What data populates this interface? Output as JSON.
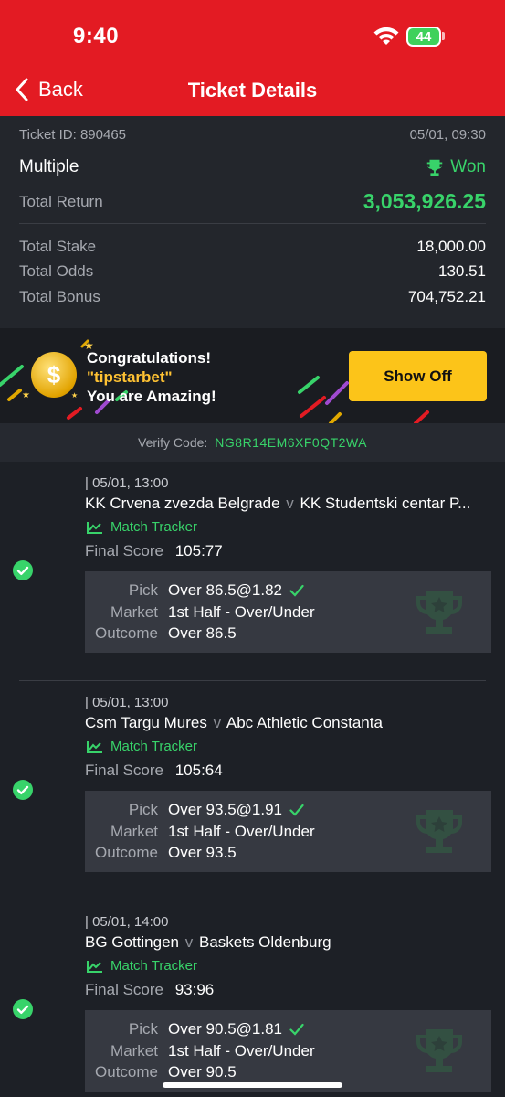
{
  "status": {
    "time": "9:40",
    "battery": "44"
  },
  "nav": {
    "back_label": "Back",
    "title": "Ticket Details"
  },
  "ticket": {
    "id_label": "Ticket ID: 890465",
    "datetime": "05/01, 09:30",
    "type": "Multiple",
    "status": "Won",
    "return_label": "Total Return",
    "return_value": "3,053,926.25",
    "stake_label": "Total Stake",
    "stake_value": "18,000.00",
    "odds_label": "Total Odds",
    "odds_value": "130.51",
    "bonus_label": "Total Bonus",
    "bonus_value": "704,752.21"
  },
  "promo": {
    "line1": "Congratulations!",
    "username": "\"tipstarbet\"",
    "line3": "You are Amazing!",
    "button": "Show Off"
  },
  "verify": {
    "label": "Verify Code:",
    "code": "NG8R14EM6XF0QT2WA"
  },
  "labels": {
    "tracker": "Match Tracker",
    "final_score": "Final Score",
    "pick": "Pick",
    "market": "Market",
    "outcome": "Outcome",
    "vs": "v"
  },
  "legs": [
    {
      "time": "| 05/01, 13:00",
      "home": "KK Crvena zvezda Belgrade",
      "away": "KK Studentski centar P...",
      "score": "105:77",
      "pick": "Over 86.5@1.82",
      "market": "1st Half - Over/Under",
      "outcome": "Over 86.5"
    },
    {
      "time": "| 05/01, 13:00",
      "home": "Csm Targu Mures",
      "away": "Abc Athletic Constanta",
      "score": "105:64",
      "pick": "Over 93.5@1.91",
      "market": "1st Half - Over/Under",
      "outcome": "Over 93.5"
    },
    {
      "time": "| 05/01, 14:00",
      "home": "BG Gottingen",
      "away": "Baskets Oldenburg",
      "score": "93:96",
      "pick": "Over 90.5@1.81",
      "market": "1st Half - Over/Under",
      "outcome": "Over 90.5"
    }
  ],
  "colors": {
    "brand_red": "#e31b23",
    "win_green": "#38d36a",
    "button_yellow": "#fcc419"
  }
}
